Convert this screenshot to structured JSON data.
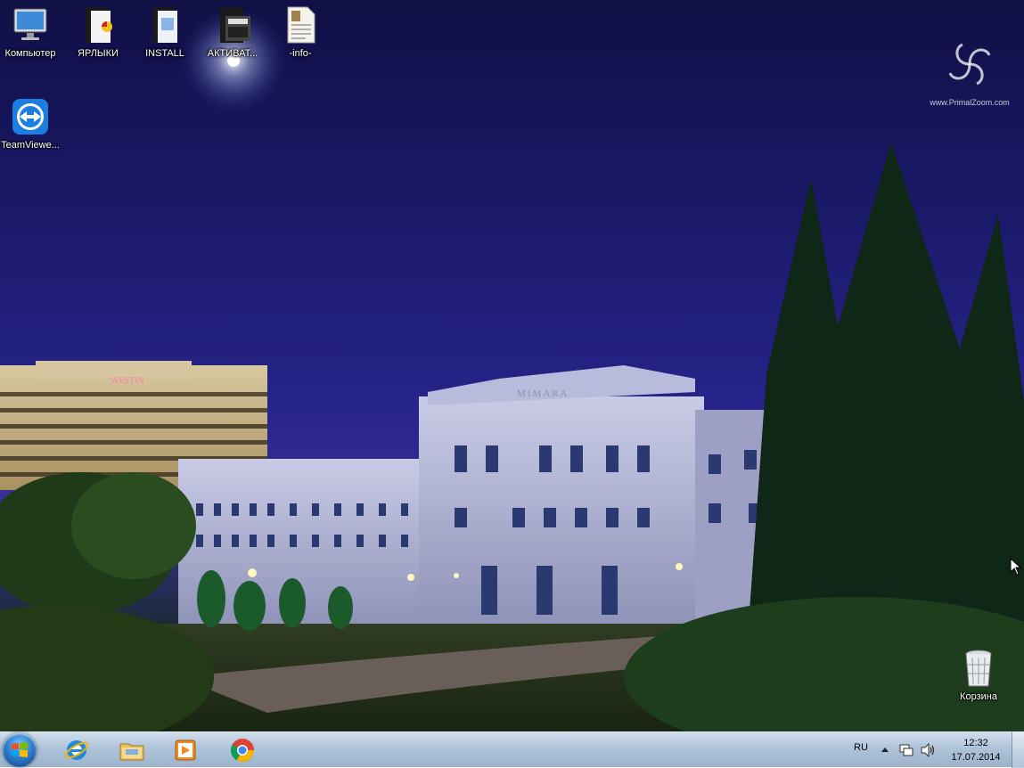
{
  "desktop_icons": [
    {
      "label": "Компьютер",
      "icon": "computer-icon"
    },
    {
      "label": "ЯРЛЫКИ",
      "icon": "folder-icon"
    },
    {
      "label": "INSTALL",
      "icon": "folder-icon"
    },
    {
      "label": "АКТИВАТ...",
      "icon": "folder-icon"
    },
    {
      "label": "-info-",
      "icon": "text-document-icon"
    },
    {
      "label": "TeamViewe...",
      "icon": "teamviewer-icon"
    },
    {
      "label": "Корзина",
      "icon": "recycle-bin-icon"
    }
  ],
  "wallpaper": {
    "watermark": "www.PrimalZoom.com",
    "hotel_sign": "WESTIN",
    "museum_sign": "MIMARA"
  },
  "taskbar": {
    "pinned": [
      "internet-explorer-icon",
      "windows-explorer-icon",
      "media-player-icon",
      "chrome-icon"
    ],
    "language": "RU",
    "time": "12:32",
    "date": "17.07.2014"
  },
  "colors": {
    "sky_top": "#100f45",
    "sky_mid": "#26238a",
    "taskbar": "#aac0d7"
  }
}
